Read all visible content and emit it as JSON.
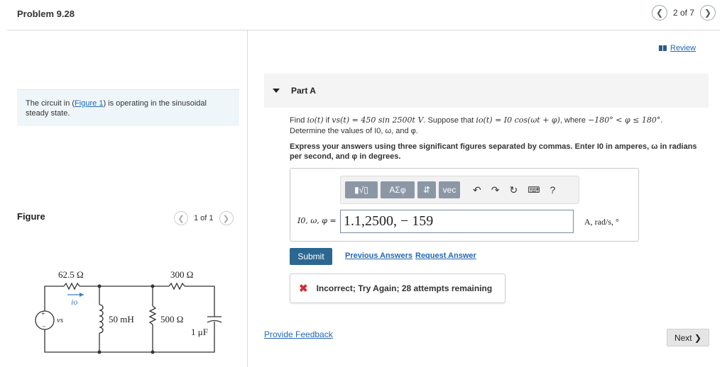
{
  "header": {
    "title": "Problem 9.28",
    "page_indicator": "2 of 7",
    "prev_icon": "chevron-left-icon",
    "next_icon": "chevron-right-icon"
  },
  "left": {
    "intro_before": "The circuit in (",
    "figure_link": "Figure 1",
    "intro_after": ") is operating in the sinusoidal steady state.",
    "figure_label": "Figure",
    "figure_count": "1 of 1",
    "circuit": {
      "r1": "62.5 Ω",
      "r2": "300 Ω",
      "current": "io",
      "source": "vs",
      "inductor": "50 mH",
      "r3": "500 Ω",
      "capacitor": "1 μF"
    }
  },
  "right": {
    "review_label": "Review",
    "part_title": "Part A",
    "question_line1_a": "Find ",
    "question_line1_b": "io(t)",
    "question_line1_c": " if ",
    "question_line1_d": "vs(t) = 450 sin 2500t V",
    "question_line1_e": ". Suppose that ",
    "question_line1_f": "io(t) = I0 cos(ωt + φ)",
    "question_line1_g": ", where ",
    "question_line1_h": "−180° < φ ≤ 180°",
    "question_line1_i": ".",
    "question_line2": "Determine the values of I0, ω, and φ.",
    "instructions": "Express your answers using three significant figures separated by commas. Enter I0 in amperes, ω in radians per second, and φ in degrees.",
    "answer_label": "I0, ω, φ =",
    "answer_value": "1.1,2500, − 159",
    "units": "A, rad/s, °",
    "toolbar": {
      "template": "▮√▯",
      "greek": "ΑΣφ",
      "arrows": "⇵",
      "vec": "vec",
      "help": "?"
    },
    "submit_label": "Submit",
    "previous_answers": "Previous Answers",
    "request_answer": "Request Answer",
    "feedback": "Incorrect; Try Again; 28 attempts remaining",
    "provide_feedback": "Provide Feedback",
    "next_label": "Next ❯"
  },
  "colors": {
    "link": "#2468b4",
    "submit_bg": "#2c6791",
    "error": "#d32f2f",
    "intro_bg": "#eef6fa"
  }
}
